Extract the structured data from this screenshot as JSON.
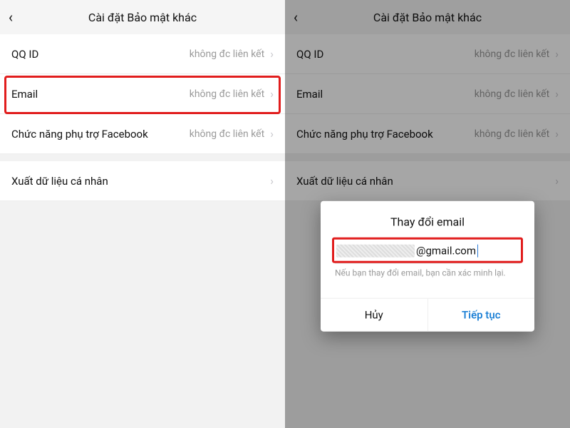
{
  "header": {
    "title": "Cài đặt Bảo mật khác"
  },
  "rows": [
    {
      "label": "QQ ID",
      "value": "không đc liên kết"
    },
    {
      "label": "Email",
      "value": "không đc liên kết"
    },
    {
      "label": "Chức năng phụ trợ Facebook",
      "value": "không đc liên kết"
    },
    {
      "label": "Xuất dữ liệu cá nhân",
      "value": ""
    }
  ],
  "dialog": {
    "title": "Thay đổi email",
    "email_suffix": "@gmail.com",
    "hint": "Nếu bạn thay đổi email, bạn cần xác minh lại.",
    "cancel": "Hủy",
    "continue": "Tiếp tục"
  }
}
